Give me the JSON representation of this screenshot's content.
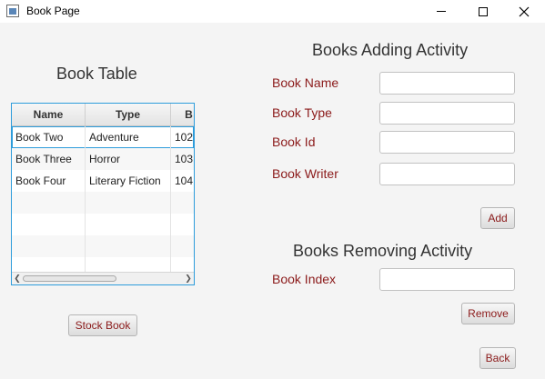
{
  "window": {
    "title": "Book Page",
    "controls": {
      "minimize": "minimize-icon",
      "maximize": "maximize-icon",
      "close": "close-icon"
    }
  },
  "left_panel": {
    "heading": "Book Table",
    "table": {
      "columns": [
        "Name",
        "Type",
        "B"
      ],
      "rows": [
        {
          "name": "Book Two",
          "type": "Adventure",
          "id": "102"
        },
        {
          "name": "Book Three",
          "type": "Horror",
          "id": "103"
        },
        {
          "name": "Book Four",
          "type": "Literary Fiction",
          "id": "104"
        },
        {
          "name": "",
          "type": "",
          "id": ""
        },
        {
          "name": "",
          "type": "",
          "id": ""
        },
        {
          "name": "",
          "type": "",
          "id": ""
        },
        {
          "name": "",
          "type": "",
          "id": ""
        }
      ],
      "selected_row": 0
    },
    "stock_button": "Stock Book"
  },
  "adding": {
    "heading": "Books Adding Activity",
    "book_name_label": "Book Name",
    "book_name_value": "",
    "book_type_label": "Book Type",
    "book_type_value": "",
    "book_id_label": "Book Id",
    "book_id_value": "",
    "book_writer_label": "Book Writer",
    "book_writer_value": "",
    "add_button": "Add"
  },
  "removing": {
    "heading": "Books Removing Activity",
    "book_index_label": "Book Index",
    "book_index_value": "",
    "remove_button": "Remove"
  },
  "back_button": "Back",
  "colors": {
    "label": "#8b1a1a",
    "table_focus_border": "#2d9cdb",
    "background": "#f4f4f4"
  }
}
